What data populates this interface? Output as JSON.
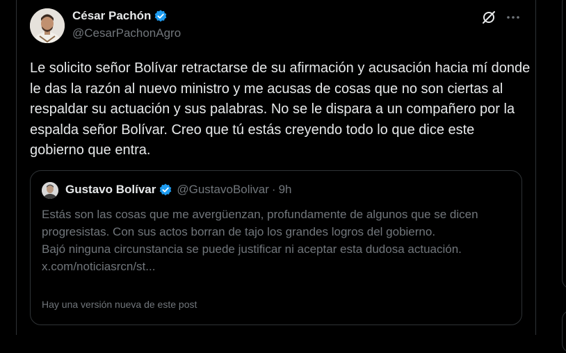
{
  "tweet": {
    "author_name": "César Pachón",
    "author_handle": "@CesarPachonAgro",
    "text": "Le solicito señor Bolívar retractarse de su afirmación y acusación hacia mí donde le das la razón al nuevo ministro y me acusas de cosas que no son ciertas al respaldar su actuación y sus palabras. No se le dispara a un compañero por la espalda señor Bolívar. Creo que tú estás creyendo todo lo que dice este gobierno que entra."
  },
  "quote": {
    "author_name": "Gustavo Bolívar",
    "author_handle": "@GustavoBolivar",
    "separator": "·",
    "time": "9h",
    "text_line1": "Estás son las cosas que me avergüenzan, profundamente de algunos que se dicen progresistas. Con sus actos borran de tajo los grandes logros del gobierno.",
    "text_line2": "Bajó ninguna circunstancia se puede justificar ni aceptar esta dudosa actuación. x.com/noticiasrcn/st...",
    "footer": "Hay una versión nueva de este post"
  },
  "colors": {
    "background": "#000000",
    "text_primary": "#e7e9ea",
    "text_secondary": "#71767b",
    "border": "#2f3336",
    "verified": "#1d9bf0"
  },
  "icons": [
    "verified-badge-icon",
    "grok-icon",
    "more-options-icon"
  ]
}
